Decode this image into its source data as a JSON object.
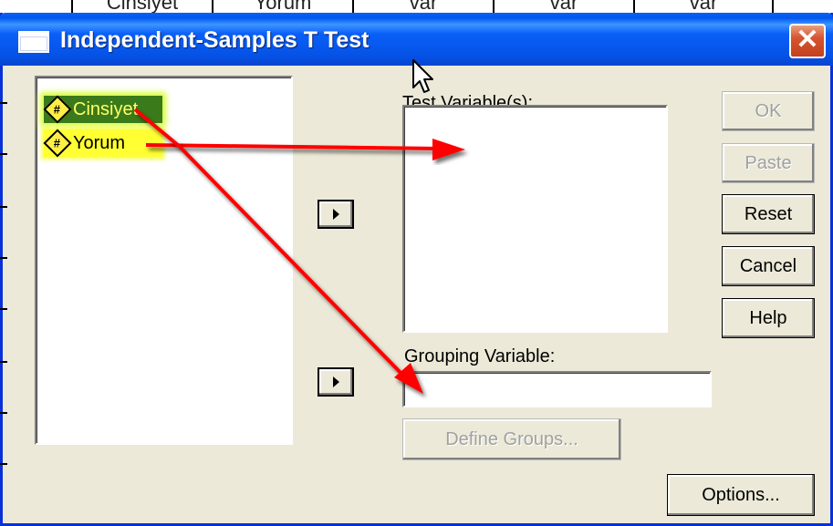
{
  "background": {
    "columns": [
      "Cinsiyet",
      "Yorum",
      "var",
      "var",
      "var"
    ]
  },
  "dialog": {
    "title": "Independent-Samples T Test",
    "close_label": "✕"
  },
  "variables": [
    {
      "name": "Cinsiyet",
      "icon": "numeric-variable-icon",
      "selected": true
    },
    {
      "name": "Yorum",
      "icon": "numeric-variable-icon",
      "selected": false
    }
  ],
  "test_variables": {
    "label": "Test Variable(s):",
    "items": []
  },
  "grouping": {
    "label": "Grouping Variable:",
    "value": ""
  },
  "buttons": {
    "ok": "OK",
    "paste": "Paste",
    "reset": "Reset",
    "cancel": "Cancel",
    "help": "Help",
    "define_groups": "Define Groups...",
    "options": "Options..."
  },
  "colors": {
    "titlebar": "#0A5FF8",
    "dialog_bg": "#ECE9D8",
    "annotation_arrow": "#FF0000",
    "highlight_selected": "#3B7A1A",
    "highlight_yellow": "#FFFF33"
  }
}
